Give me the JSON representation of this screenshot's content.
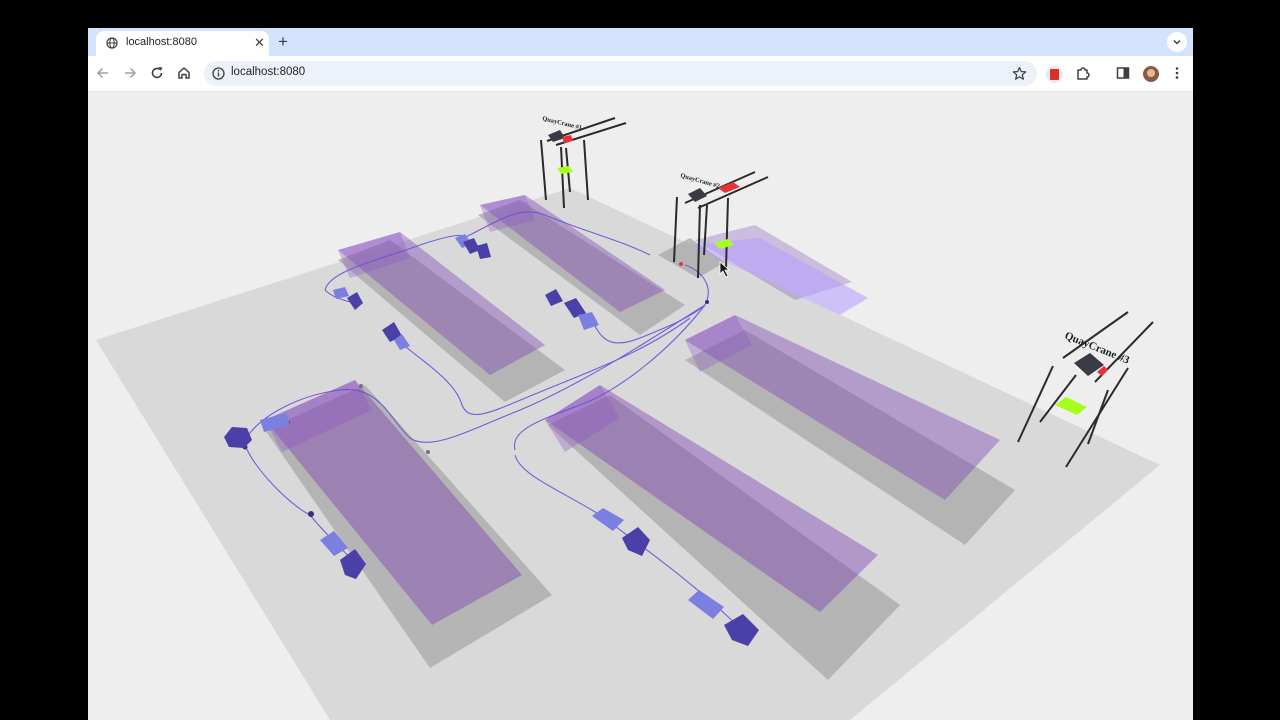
{
  "tab": {
    "title": "localhost:8080"
  },
  "address_bar": {
    "url": "localhost:8080"
  },
  "scene": {
    "crane_labels": [
      "QuayCrane #1",
      "QuayCrane #2",
      "QuayCrane #3"
    ]
  },
  "colors": {
    "chrome_tab_strip": "#d3e3fd",
    "omnibox": "#edf2fa",
    "ground": "#d9d9d9",
    "background": "#eeeeee",
    "container": "#7a3fb3",
    "vehicle": "#4b3fa8",
    "trailer": "#7b7fe0",
    "crane_highlight": "#e8333b",
    "crane_target": "#a6ff1a"
  },
  "icons": [
    "globe-icon",
    "close-icon",
    "plus-icon",
    "chevron-down-icon",
    "back-icon",
    "forward-icon",
    "reload-icon",
    "home-icon",
    "info-icon",
    "star-icon",
    "extension-icon",
    "puzzle-icon",
    "sidebar-icon",
    "avatar",
    "more-icon",
    "cursor-icon"
  ]
}
